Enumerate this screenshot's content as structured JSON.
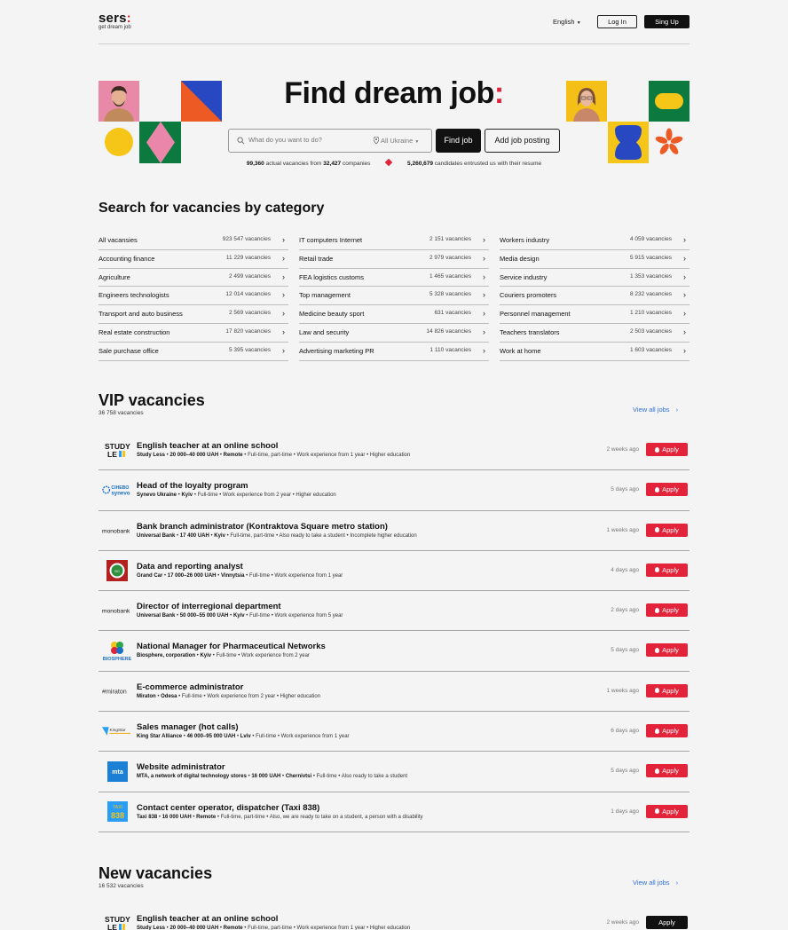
{
  "header": {
    "logo": "sers",
    "logo_colon": ":",
    "tagline": "get dream job",
    "language": "English",
    "login": "Log In",
    "signup": "Sing Up"
  },
  "hero": {
    "title": "Find dream job",
    "title_colon": ":",
    "search_placeholder": "What do you want to do?",
    "location": "All Ukraine",
    "find_button": "Find job",
    "post_button": "Add job posting",
    "stats_vacancies": "99,360",
    "stats_text1": "actual vacancies from",
    "stats_companies": "32,427",
    "stats_text2": "companies",
    "stats_candidates": "5,260,679",
    "stats_text3": "candidates entrusted us with their resume"
  },
  "categories": {
    "title": "Search for vacancies by category",
    "columns": [
      [
        {
          "name": "All vacansies",
          "count": "923 547 vacancies"
        },
        {
          "name": "Accounting finance",
          "count": "11 229 vacancies"
        },
        {
          "name": "Agriculture",
          "count": "2 499 vacancies"
        },
        {
          "name": "Engineers technologists",
          "count": "12 014 vacancies"
        },
        {
          "name": "Transport and auto business",
          "count": "2 569 vacancies"
        },
        {
          "name": "Real estate construction",
          "count": "17 820 vacancies"
        },
        {
          "name": "Sale purchase office",
          "count": "5 395 vacancies"
        }
      ],
      [
        {
          "name": "IT computers Internet",
          "count": "2 151 vacancies"
        },
        {
          "name": "Retail trade",
          "count": "2 979 vacancies"
        },
        {
          "name": "FEA logistics customs",
          "count": "1 465 vacancies"
        },
        {
          "name": "Top management",
          "count": "5 328 vacancies"
        },
        {
          "name": "Medicine beauty sport",
          "count": "631 vacancies"
        },
        {
          "name": "Law and security",
          "count": "14 826 vacancies"
        },
        {
          "name": "Advertising marketing PR",
          "count": "1 110 vacancies"
        }
      ],
      [
        {
          "name": "Workers industry",
          "count": "4 059 vacancies"
        },
        {
          "name": "Media design",
          "count": "5 915 vacancies"
        },
        {
          "name": "Service industry",
          "count": "1 353 vacancies"
        },
        {
          "name": "Couriers promoters",
          "count": "8 232 vacancies"
        },
        {
          "name": "Personnel management",
          "count": "1 210 vacancies"
        },
        {
          "name": "Teachers translators",
          "count": "2 503 vacancies"
        },
        {
          "name": "Work at home",
          "count": "1 603 vacancies"
        }
      ]
    ]
  },
  "vip": {
    "title": "VIP vacancies",
    "count": "36 758 vacancies",
    "view_all": "View all jobs",
    "apply": "Apply",
    "jobs": [
      {
        "title": "English teacher at an online school",
        "company": "Study Less",
        "salary": "20 000–40 000 UAH",
        "location": "Remote",
        "details": "Full-time, part-time • Work experience from 1 year • Higher education",
        "time": "2 weeks ago",
        "logo": "STUDY LESS"
      },
      {
        "title": "Head of the loyalty program",
        "company": "Synevo Ukraine",
        "salary": "",
        "location": "Kyiv",
        "details": "Full-time • Work experience from 2 year • Higher education",
        "time": "5 days ago",
        "logo": "synevo"
      },
      {
        "title": "Bank branch administrator (Kontraktova Square metro station)",
        "company": "Universal Bank",
        "salary": "17 400 UAH",
        "location": "Kyiv",
        "details": "Full-time, part-time • Also ready to take a student • Incomplete higher education",
        "time": "1 weeks ago",
        "logo": "monobank"
      },
      {
        "title": "Data and reporting analyst",
        "company": "Grand Car",
        "salary": "17 000–26 000 UAH",
        "location": "Vinnytsia",
        "details": "Full-time • Work experience from 1 year",
        "time": "4 days ago",
        "logo": "grandcar"
      },
      {
        "title": "Director of interregional department",
        "company": "Universal Bank",
        "salary": "50 000–55 000 UAH",
        "location": "Kyiv",
        "details": "Full-time • Work experience from 5 year",
        "time": "2 days ago",
        "logo": "monobank"
      },
      {
        "title": "National Manager for Pharmaceutical Networks",
        "company": "Biosphere, corporation",
        "salary": "",
        "location": "Kyiv",
        "details": "Full-time • Work experience from 2 year",
        "time": "5 days ago",
        "logo": "BIOSPHERE"
      },
      {
        "title": "E-commerce administrator",
        "company": "Miraton",
        "salary": "",
        "location": "Odesa",
        "details": "Full-time • Work experience from 2 year • Higher education",
        "time": "1 weeks ago",
        "logo": "miraton"
      },
      {
        "title": "Sales manager (hot calls)",
        "company": "King Star Alliance",
        "salary": "46 000–95 000 UAH",
        "location": "Lviv",
        "details": "Full-time • Work experience from 1 year",
        "time": "6 days ago",
        "logo": "KingStar"
      },
      {
        "title": "Website administrator",
        "company": "MTA, a network of digital technology stores",
        "salary": "16 000 UAH",
        "location": "Chernivtsi",
        "details": "Full-time • Also ready to take a student",
        "time": "5 days ago",
        "logo": "mta"
      },
      {
        "title": "Contact center operator, dispatcher (Taxi 838)",
        "company": "Taxi 838",
        "salary": "16 000 UAH",
        "location": "Remote",
        "details": "Full-time, part-time • Also, we are ready to take on a student, a person with a disability",
        "time": "1 days ago",
        "logo": "838"
      }
    ]
  },
  "new": {
    "title": "New vacancies",
    "count": "16 532 vacancies",
    "view_all": "View all jobs",
    "apply": "Apply",
    "jobs": [
      {
        "title": "English teacher at an online school",
        "company": "Study Less",
        "salary": "20 000–40 000 UAH",
        "location": "Remote",
        "details": "Full-time, part-time • Work experience from 1 year • Higher education",
        "time": "2 weeks ago",
        "logo": "STUDY LESS"
      }
    ]
  }
}
